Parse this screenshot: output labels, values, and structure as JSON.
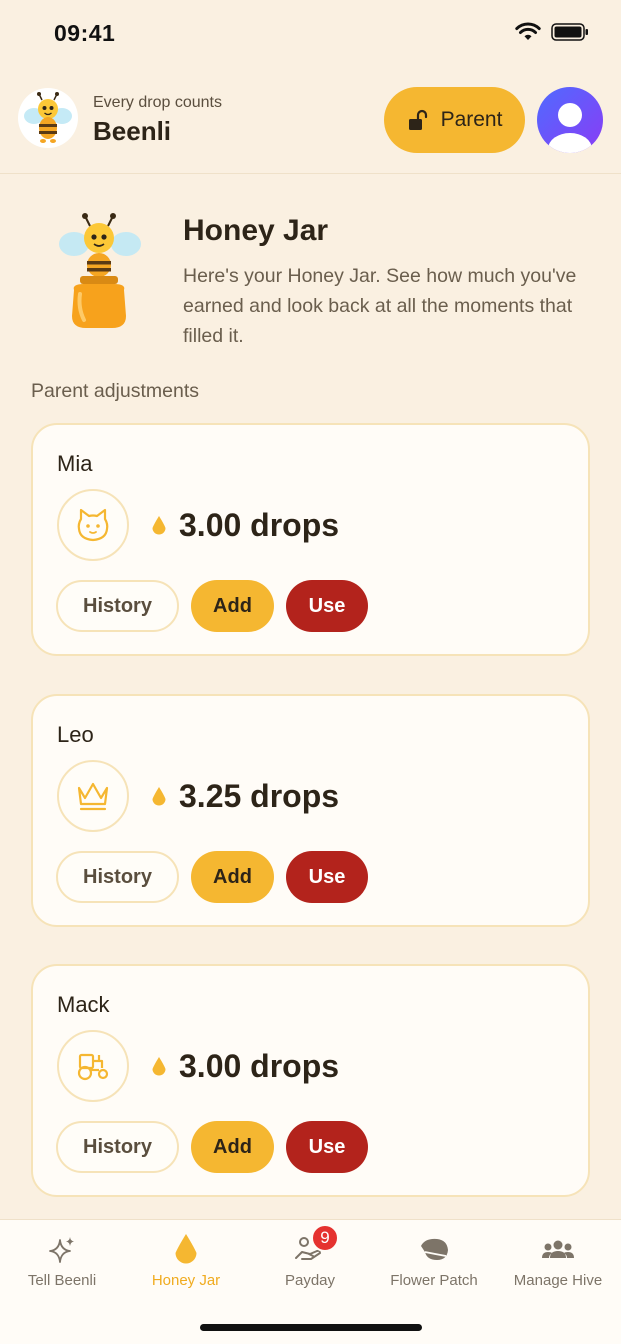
{
  "status_bar": {
    "time": "09:41"
  },
  "header": {
    "tagline": "Every drop counts",
    "app_name": "Beenli",
    "parent_button_label": "Parent"
  },
  "intro": {
    "title": "Honey Jar",
    "description": "Here's your Honey Jar. See how much you've earned and look back at all the moments that filled it."
  },
  "section_label": "Parent adjustments",
  "children": [
    {
      "name": "Mia",
      "icon": "cat-icon",
      "balance": "3.00 drops",
      "history_label": "History",
      "add_label": "Add",
      "use_label": "Use"
    },
    {
      "name": "Leo",
      "icon": "crown-icon",
      "balance": "3.25 drops",
      "history_label": "History",
      "add_label": "Add",
      "use_label": "Use"
    },
    {
      "name": "Mack",
      "icon": "tractor-icon",
      "balance": "3.00 drops",
      "history_label": "History",
      "add_label": "Add",
      "use_label": "Use"
    }
  ],
  "tabs": [
    {
      "label": "Tell Beenli",
      "icon": "sparkles-icon",
      "active": false
    },
    {
      "label": "Honey Jar",
      "icon": "drop-icon",
      "active": true
    },
    {
      "label": "Payday",
      "icon": "payday-icon",
      "active": false,
      "badge": "9"
    },
    {
      "label": "Flower Patch",
      "icon": "leaf-icon",
      "active": false
    },
    {
      "label": "Manage Hive",
      "icon": "group-icon",
      "active": false
    }
  ],
  "colors": {
    "background": "#faf0e1",
    "accent": "#f5b731",
    "use_button": "#b3231c",
    "badge": "#e5322f"
  }
}
